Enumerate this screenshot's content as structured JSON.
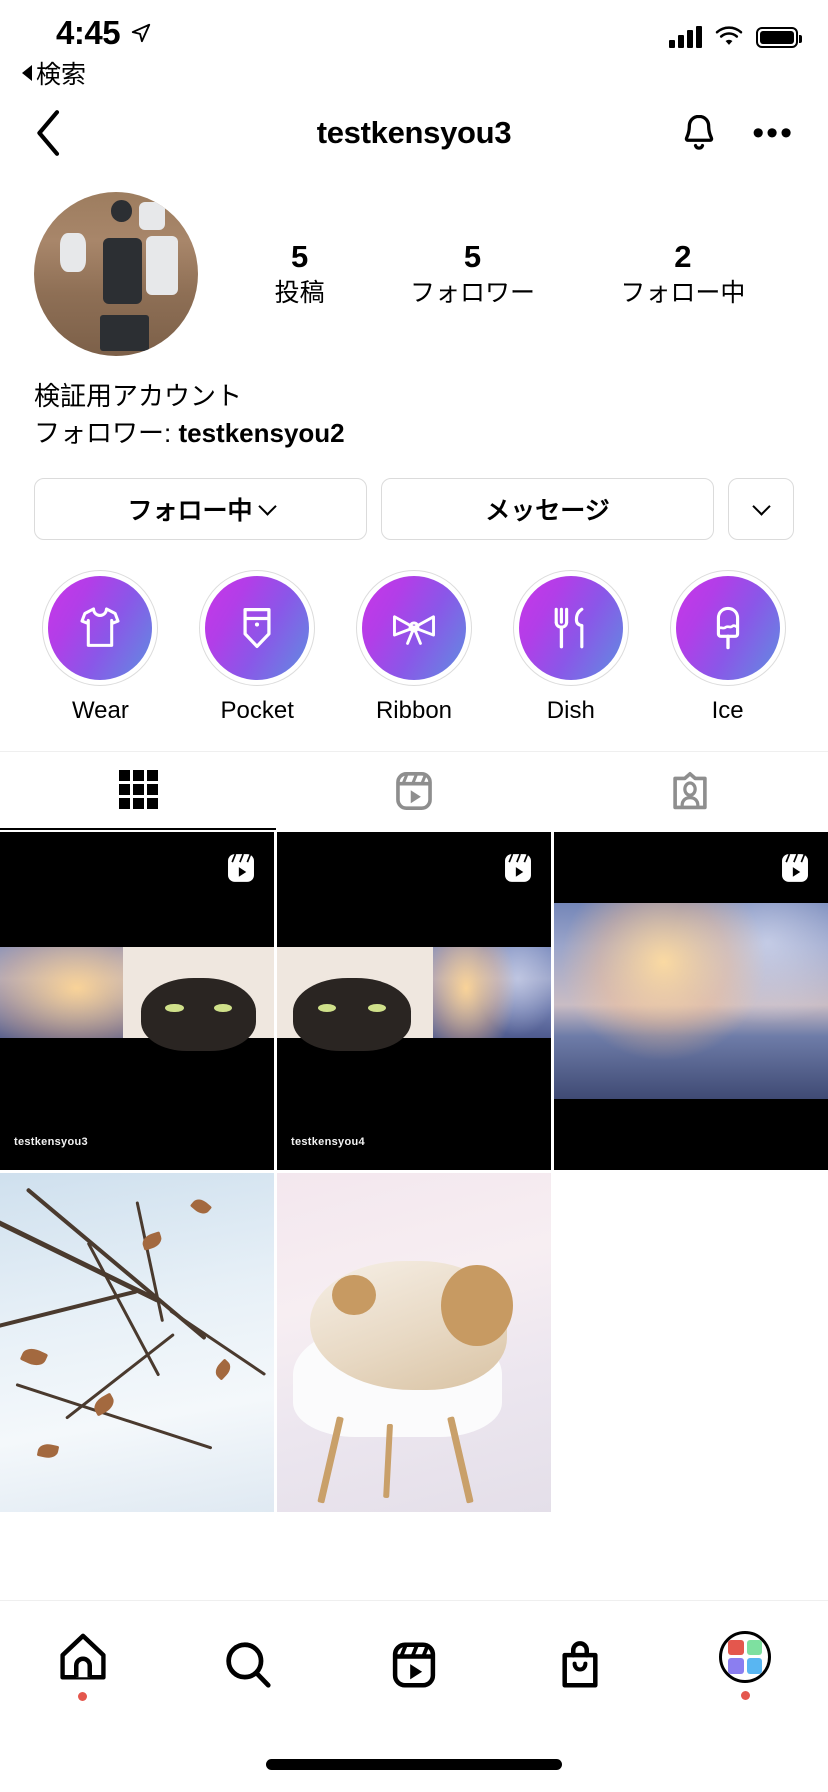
{
  "status_bar": {
    "time": "4:45",
    "back_label": "検索",
    "location_icon": "location-arrow-icon",
    "signal_icon": "cellular-signal-icon",
    "wifi_icon": "wifi-icon",
    "battery_icon": "battery-icon"
  },
  "nav": {
    "back_icon": "chevron-left-icon",
    "title": "testkensyou3",
    "notify_icon": "bell-icon",
    "more_icon": "more-options-icon"
  },
  "profile": {
    "avatar_alt": "phones-on-wooden-desk-photo",
    "stats": [
      {
        "value": "5",
        "label": "投稿"
      },
      {
        "value": "5",
        "label": "フォロワー"
      },
      {
        "value": "2",
        "label": "フォロー中"
      }
    ],
    "bio_name": "検証用アカウント",
    "bio_follower_prefix": "フォロワー: ",
    "bio_follower_name": "testkensyou2"
  },
  "actions": {
    "following_label": "フォロー中",
    "message_label": "メッセージ",
    "more_icon": "chevron-down-icon"
  },
  "highlights": [
    {
      "label": "Wear",
      "icon": "tshirt-icon"
    },
    {
      "label": "Pocket",
      "icon": "pocket-icon"
    },
    {
      "label": "Ribbon",
      "icon": "ribbon-icon"
    },
    {
      "label": "Dish",
      "icon": "cutlery-icon"
    },
    {
      "label": "Ice",
      "icon": "popsicle-icon"
    }
  ],
  "tabs": [
    {
      "name": "grid-tab",
      "icon": "grid-icon",
      "active": true
    },
    {
      "name": "reels-tab",
      "icon": "reels-icon",
      "active": false
    },
    {
      "name": "tagged-tab",
      "icon": "tagged-icon",
      "active": false
    }
  ],
  "posts": [
    {
      "type": "reel",
      "badge": "reels-icon",
      "watermark": "testkensyou3",
      "content": "sunset-sky-and-black-cat"
    },
    {
      "type": "reel",
      "badge": "reels-icon",
      "watermark": "testkensyou4",
      "content": "black-cat-and-sunset-sky"
    },
    {
      "type": "reel",
      "badge": "reels-icon",
      "watermark": "",
      "content": "sunset-clouds-over-sea"
    },
    {
      "type": "photo",
      "badge": "",
      "watermark": "",
      "content": "bare-branches-winter-sky"
    },
    {
      "type": "photo",
      "badge": "",
      "watermark": "",
      "content": "ginger-cat-on-white-chair"
    }
  ],
  "bottom_nav": [
    {
      "name": "home-tab",
      "icon": "home-icon",
      "badge": true
    },
    {
      "name": "search-tab",
      "icon": "search-icon",
      "badge": false
    },
    {
      "name": "reels-tab",
      "icon": "reels-icon",
      "badge": false
    },
    {
      "name": "shop-tab",
      "icon": "shopping-bag-icon",
      "badge": false
    },
    {
      "name": "profile-tab",
      "icon": "profile-avatar-icon",
      "badge": true
    }
  ],
  "colors": {
    "highlight_gradient_start": "#c837e8",
    "highlight_gradient_end": "#5e8fe0",
    "badge_red": "#e4574d",
    "border_gray": "#dbdbdb"
  }
}
